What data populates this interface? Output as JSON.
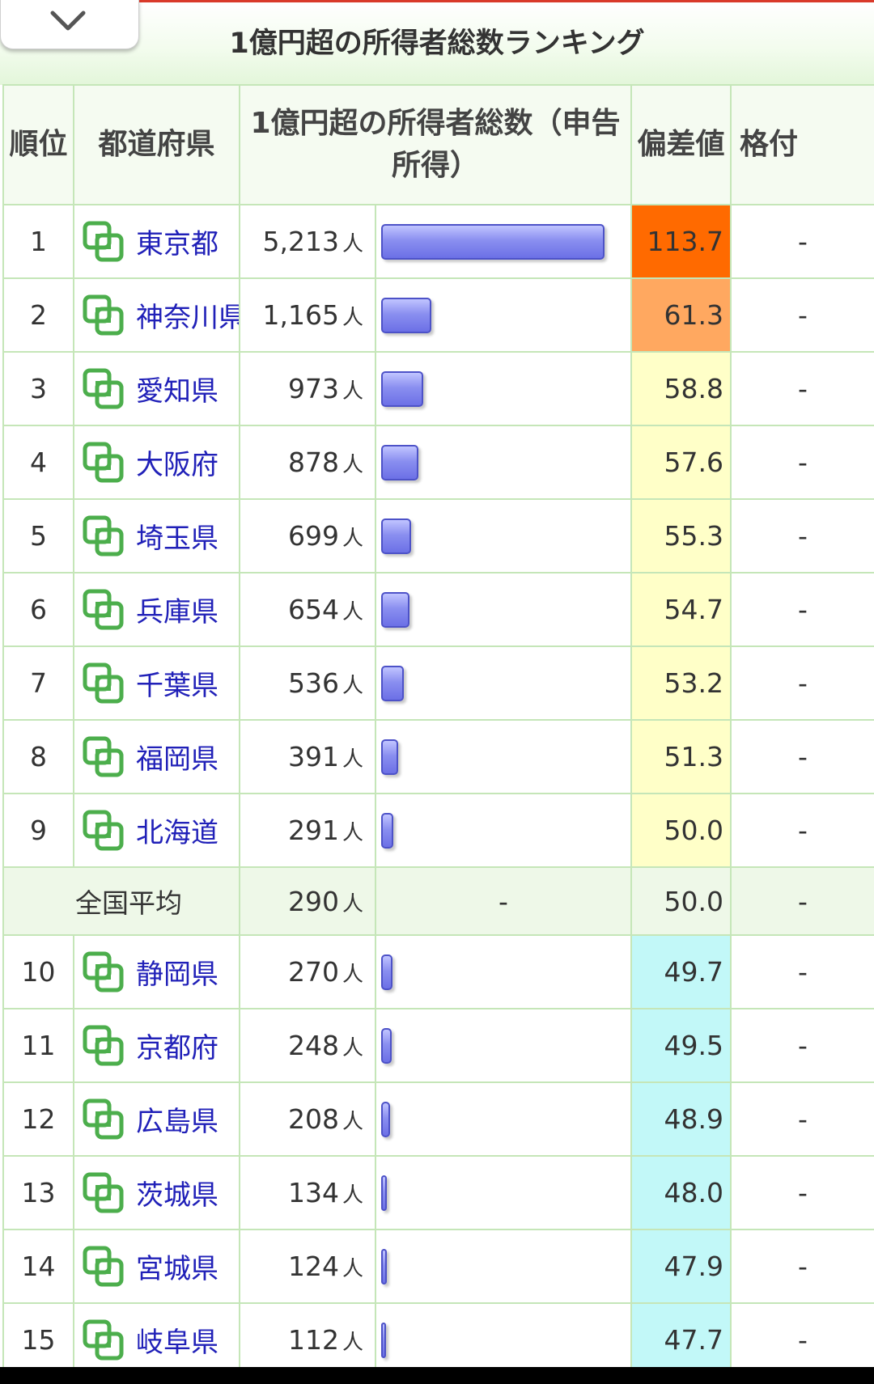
{
  "title": "1億円超の所得者総数ランキング",
  "header": {
    "rank": "順位",
    "prefecture": "都道府県",
    "total": "1億円超の所得者総数（申告所得）",
    "deviation": "偏差値",
    "grade": "格付"
  },
  "unit": "人",
  "bar_max": 5213,
  "colors": {
    "dev_top1": "#ff6a00",
    "dev_top2": "#ffa860",
    "dev_above_avg": "#ffffc8",
    "dev_below_avg": "#c2f8f8"
  },
  "rows_before_avg": [
    {
      "rank": "1",
      "name": "東京都",
      "count": "5,213",
      "value": 5213,
      "deviation": "113.7",
      "grade": "-"
    },
    {
      "rank": "2",
      "name": "神奈川県",
      "count": "1,165",
      "value": 1165,
      "deviation": "61.3",
      "grade": "-"
    },
    {
      "rank": "3",
      "name": "愛知県",
      "count": "973",
      "value": 973,
      "deviation": "58.8",
      "grade": "-"
    },
    {
      "rank": "4",
      "name": "大阪府",
      "count": "878",
      "value": 878,
      "deviation": "57.6",
      "grade": "-"
    },
    {
      "rank": "5",
      "name": "埼玉県",
      "count": "699",
      "value": 699,
      "deviation": "55.3",
      "grade": "-"
    },
    {
      "rank": "6",
      "name": "兵庫県",
      "count": "654",
      "value": 654,
      "deviation": "54.7",
      "grade": "-"
    },
    {
      "rank": "7",
      "name": "千葉県",
      "count": "536",
      "value": 536,
      "deviation": "53.2",
      "grade": "-"
    },
    {
      "rank": "8",
      "name": "福岡県",
      "count": "391",
      "value": 391,
      "deviation": "51.3",
      "grade": "-"
    },
    {
      "rank": "9",
      "name": "北海道",
      "count": "291",
      "value": 291,
      "deviation": "50.0",
      "grade": "-"
    }
  ],
  "average": {
    "label": "全国平均",
    "count": "290",
    "bar": "-",
    "deviation": "50.0",
    "grade": "-"
  },
  "rows_after_avg": [
    {
      "rank": "10",
      "name": "静岡県",
      "count": "270",
      "value": 270,
      "deviation": "49.7",
      "grade": "-"
    },
    {
      "rank": "11",
      "name": "京都府",
      "count": "248",
      "value": 248,
      "deviation": "49.5",
      "grade": "-"
    },
    {
      "rank": "12",
      "name": "広島県",
      "count": "208",
      "value": 208,
      "deviation": "48.9",
      "grade": "-"
    },
    {
      "rank": "13",
      "name": "茨城県",
      "count": "134",
      "value": 134,
      "deviation": "48.0",
      "grade": "-"
    },
    {
      "rank": "14",
      "name": "宮城県",
      "count": "124",
      "value": 124,
      "deviation": "47.9",
      "grade": "-"
    },
    {
      "rank": "15",
      "name": "岐阜県",
      "count": "112",
      "value": 112,
      "deviation": "47.7",
      "grade": "-"
    }
  ]
}
